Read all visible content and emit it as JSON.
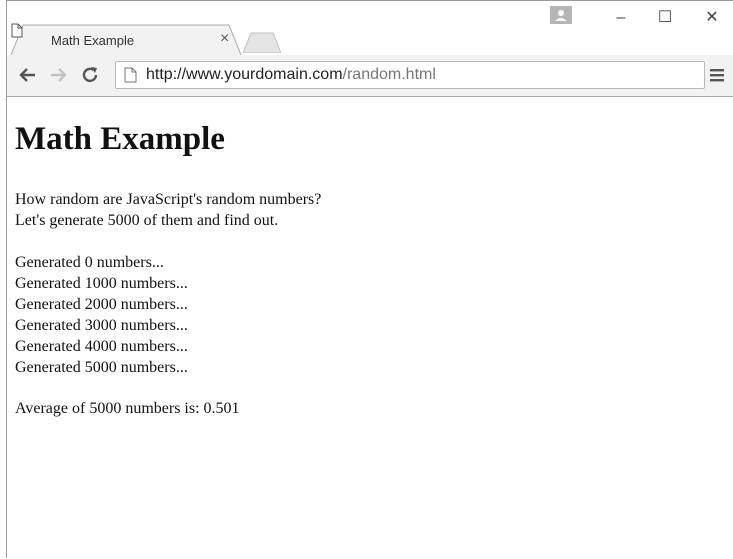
{
  "tab": {
    "title": "Math Example",
    "close_icon": "close-icon",
    "page_icon": "page-icon"
  },
  "window_controls": {
    "minimize": "–",
    "maximize": "☐",
    "close": "✕"
  },
  "address_bar": {
    "url_domain": "http://www.yourdomain.com",
    "url_path": "/random.html"
  },
  "page": {
    "heading": "Math Example",
    "intro": [
      "How random are JavaScript's random numbers?",
      "Let's generate 5000 of them and find out."
    ],
    "progress": [
      "Generated 0 numbers...",
      "Generated 1000 numbers...",
      "Generated 2000 numbers...",
      "Generated 3000 numbers...",
      "Generated 4000 numbers...",
      "Generated 5000 numbers..."
    ],
    "result": "Average of 5000 numbers is: 0.501"
  }
}
